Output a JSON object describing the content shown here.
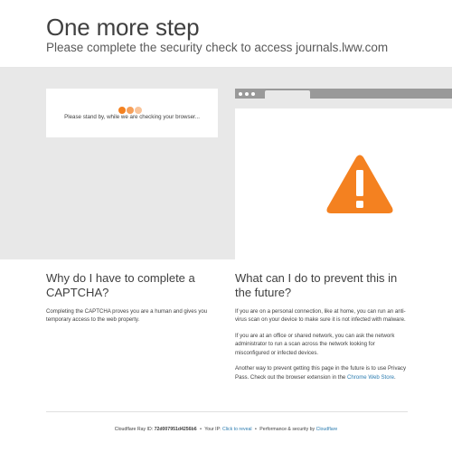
{
  "header": {
    "title": "One more step",
    "subtitle": "Please complete the security check to access journals.lww.com"
  },
  "checking": {
    "message": "Please stand by, while we are checking your browser..."
  },
  "icons": {
    "loading": "loading-dots-icon",
    "warning": "warning-triangle-icon"
  },
  "colors": {
    "accent": "#f48120",
    "link": "#2c7cb0",
    "band": "#e8e8e8"
  },
  "why": {
    "heading": "Why do I have to complete a CAPTCHA?",
    "text": "Completing the CAPTCHA proves you are a human and gives you temporary access to the web property."
  },
  "prevent": {
    "heading": "What can I do to prevent this in the future?",
    "p1": "If you are on a personal connection, like at home, you can run an anti-virus scan on your device to make sure it is not infected with malware.",
    "p2": "If you are at an office or shared network, you can ask the network administrator to run a scan across the network looking for misconfigured or infected devices.",
    "p3": "Another way to prevent getting this page in the future is to use Privacy Pass. Check out the browser extension in the",
    "p3_link": "Chrome Web Store",
    "p3_end": "."
  },
  "footer": {
    "ray_label": "Cloudflare Ray ID:",
    "ray_id": "72d007951d4256b6",
    "sep": "•",
    "ip_label": "Your IP:",
    "ip_link": "Click to reveal",
    "perf_label": "Performance & security by",
    "perf_link": "Cloudflare"
  }
}
